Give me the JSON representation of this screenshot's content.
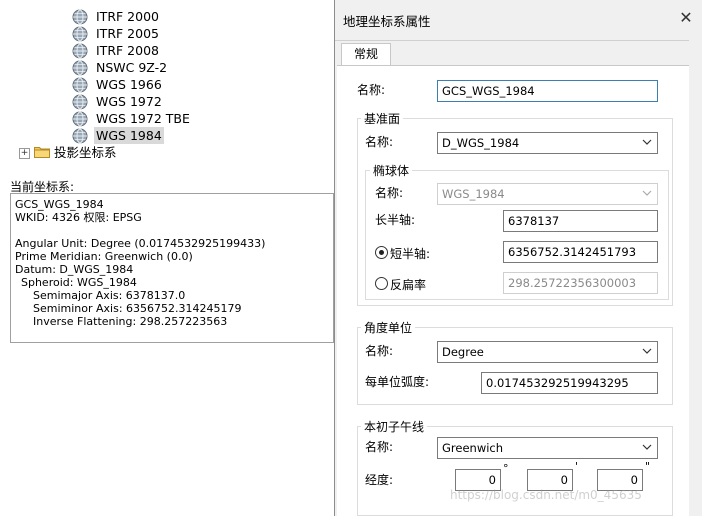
{
  "tree": {
    "items": [
      {
        "label": "ITRF 2000",
        "selected": false
      },
      {
        "label": "ITRF 2005",
        "selected": false
      },
      {
        "label": "ITRF 2008",
        "selected": false
      },
      {
        "label": "NSWC 9Z-2",
        "selected": false
      },
      {
        "label": "WGS 1966",
        "selected": false
      },
      {
        "label": "WGS 1972",
        "selected": false
      },
      {
        "label": "WGS 1972 TBE",
        "selected": false
      },
      {
        "label": "WGS 1984",
        "selected": true
      }
    ],
    "projected_folder": "投影坐标系",
    "expander_symbol": "+"
  },
  "current": {
    "label": "当前坐标系:",
    "lines": [
      "GCS_WGS_1984",
      "WKID: 4326 权限: EPSG",
      "",
      "Angular Unit: Degree (0.0174532925199433)",
      "Prime Meridian: Greenwich (0.0)",
      "Datum: D_WGS_1984",
      "  Spheroid: WGS_1984",
      "    Semimajor Axis: 6378137.0",
      "    Semiminor Axis: 6356752.314245179",
      "    Inverse Flattening: 298.257223563"
    ]
  },
  "dialog": {
    "title": "地理坐标系属性",
    "close_symbol": "✕",
    "tab_label": "常规",
    "name_label": "名称:",
    "name_value": "GCS_WGS_1984",
    "datum": {
      "title": "基准面",
      "name_label": "名称:",
      "name_value": "D_WGS_1984",
      "spheroid": {
        "title": "椭球体",
        "name_label": "名称:",
        "name_value": "WGS_1984",
        "semimajor_label": "长半轴:",
        "semimajor_value": "6378137",
        "semiminor_label": "短半轴:",
        "semiminor_value": "6356752.3142451793",
        "flattening_label": "反扁率",
        "flattening_value": "298.25722356300003",
        "selected_option": "短半轴"
      }
    },
    "angular_unit": {
      "title": "角度单位",
      "name_label": "名称:",
      "name_value": "Degree",
      "radians_label": "每单位弧度:",
      "radians_value": "0.017453292519943295"
    },
    "prime_meridian": {
      "title": "本初子午线",
      "name_label": "名称:",
      "name_value": "Greenwich",
      "longitude_label": "经度:",
      "degrees": "0",
      "minutes": "0",
      "seconds": "0",
      "degree_symbol": "°",
      "minute_symbol": "'",
      "second_symbol": "\""
    }
  },
  "watermark": "https://blog.csdn.net/m0_45635"
}
